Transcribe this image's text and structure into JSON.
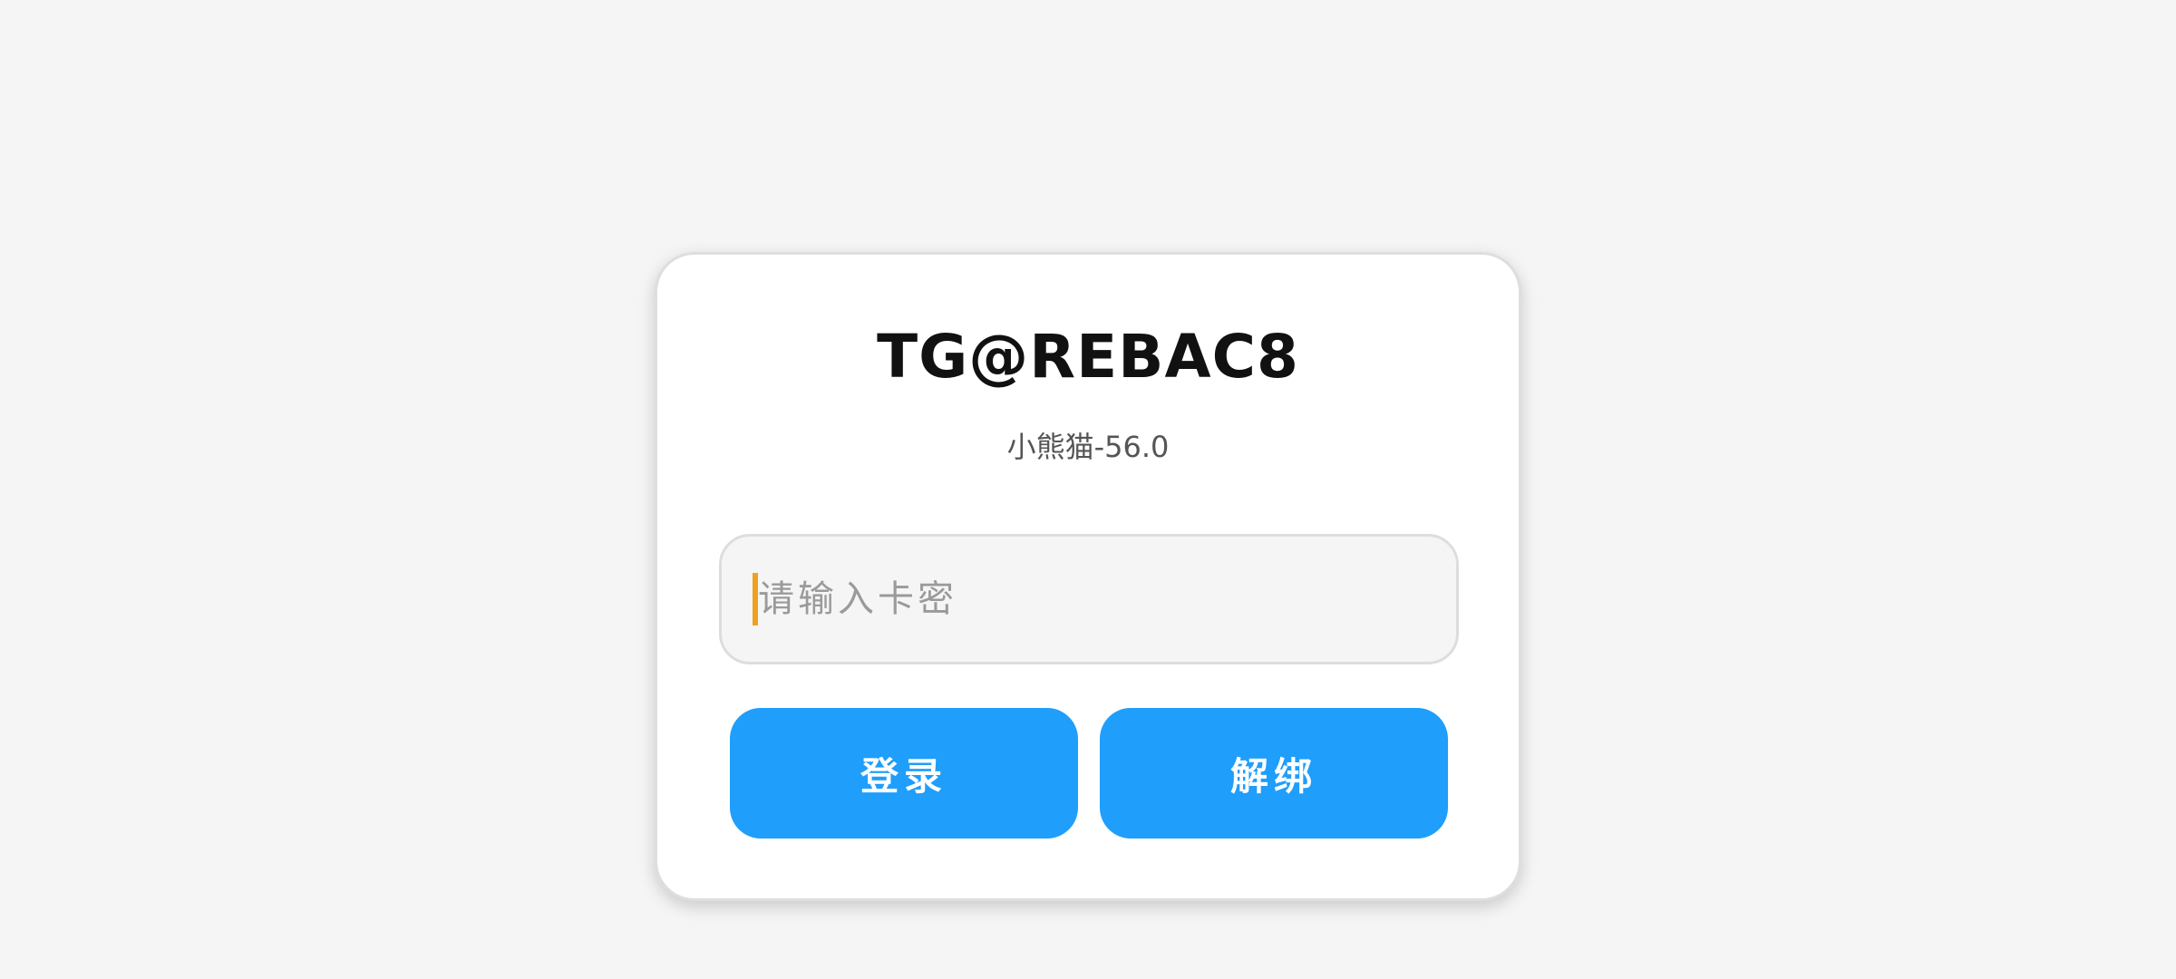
{
  "login_card": {
    "title": "TG@REBAC8",
    "subtitle": "小熊猫-56.0",
    "input": {
      "value": "",
      "placeholder": "请输入卡密"
    },
    "login_label": "登录",
    "unbind_label": "解绑"
  },
  "colors": {
    "background": "#f5f5f5",
    "card": "#ffffff",
    "button": "#1f9efc",
    "caret": "#f0a020",
    "placeholder": "#9a9a9a"
  }
}
